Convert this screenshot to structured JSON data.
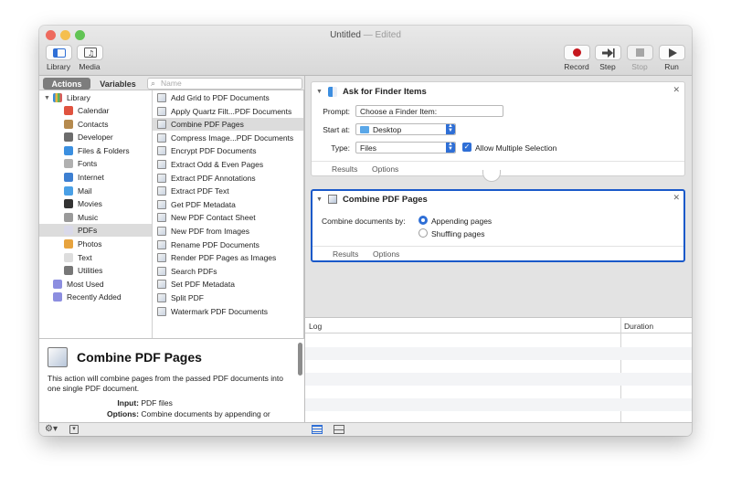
{
  "window": {
    "title": "Untitled",
    "edited": "— Edited"
  },
  "colors": {
    "close": "#ee6a5e",
    "minimize": "#f5bf4f",
    "zoom": "#61c454",
    "selection_blue": "#1a59c9",
    "record_red": "#c5161d"
  },
  "toolbar": {
    "library_label": "Library",
    "media_label": "Media",
    "record_label": "Record",
    "step_label": "Step",
    "stop_label": "Stop",
    "run_label": "Run"
  },
  "tabs": {
    "actions": "Actions",
    "variables": "Variables",
    "search_placeholder": "Name"
  },
  "library": {
    "root": "Library",
    "items": [
      {
        "label": "Calendar",
        "icon": "calendar-icon"
      },
      {
        "label": "Contacts",
        "icon": "contacts-icon"
      },
      {
        "label": "Developer",
        "icon": "developer-icon"
      },
      {
        "label": "Files & Folders",
        "icon": "finder-icon"
      },
      {
        "label": "Fonts",
        "icon": "fonts-icon"
      },
      {
        "label": "Internet",
        "icon": "globe-icon"
      },
      {
        "label": "Mail",
        "icon": "mail-icon"
      },
      {
        "label": "Movies",
        "icon": "movies-icon"
      },
      {
        "label": "Music",
        "icon": "music-icon"
      },
      {
        "label": "PDFs",
        "icon": "pdf-icon",
        "selected": true
      },
      {
        "label": "Photos",
        "icon": "photos-icon"
      },
      {
        "label": "Text",
        "icon": "text-icon"
      },
      {
        "label": "Utilities",
        "icon": "utilities-icon"
      }
    ],
    "most_used": "Most Used",
    "recently_added": "Recently Added"
  },
  "actions_list": [
    "Add Grid to PDF Documents",
    "Apply Quartz Filt...PDF Documents",
    "Combine PDF Pages",
    "Compress Image...PDF Documents",
    "Encrypt PDF Documents",
    "Extract Odd & Even Pages",
    "Extract PDF Annotations",
    "Extract PDF Text",
    "Get PDF Metadata",
    "New PDF Contact Sheet",
    "New PDF from Images",
    "Rename PDF Documents",
    "Render PDF Pages as Images",
    "Search PDFs",
    "Set PDF Metadata",
    "Split PDF",
    "Watermark PDF Documents"
  ],
  "selected_action_index": 2,
  "description": {
    "title": "Combine PDF Pages",
    "body": "This action will combine pages from the passed PDF documents into one single PDF document.",
    "input_label": "Input:",
    "input_value": "PDF files",
    "options_label": "Options:",
    "options_value": "Combine documents by appending or"
  },
  "workflow": {
    "card1": {
      "title": "Ask for Finder Items",
      "prompt_label": "Prompt:",
      "prompt_value": "Choose a Finder Item:",
      "start_label": "Start at:",
      "start_value": "Desktop",
      "type_label": "Type:",
      "type_value": "Files",
      "allow_multiple": "Allow Multiple Selection",
      "allow_multiple_checked": true,
      "results": "Results",
      "options": "Options"
    },
    "card2": {
      "title": "Combine PDF Pages",
      "combine_label": "Combine documents by:",
      "option1": "Appending pages",
      "option2": "Shuffling pages",
      "selected_option": 1,
      "results": "Results",
      "options": "Options"
    }
  },
  "log": {
    "col_log": "Log",
    "col_duration": "Duration"
  }
}
